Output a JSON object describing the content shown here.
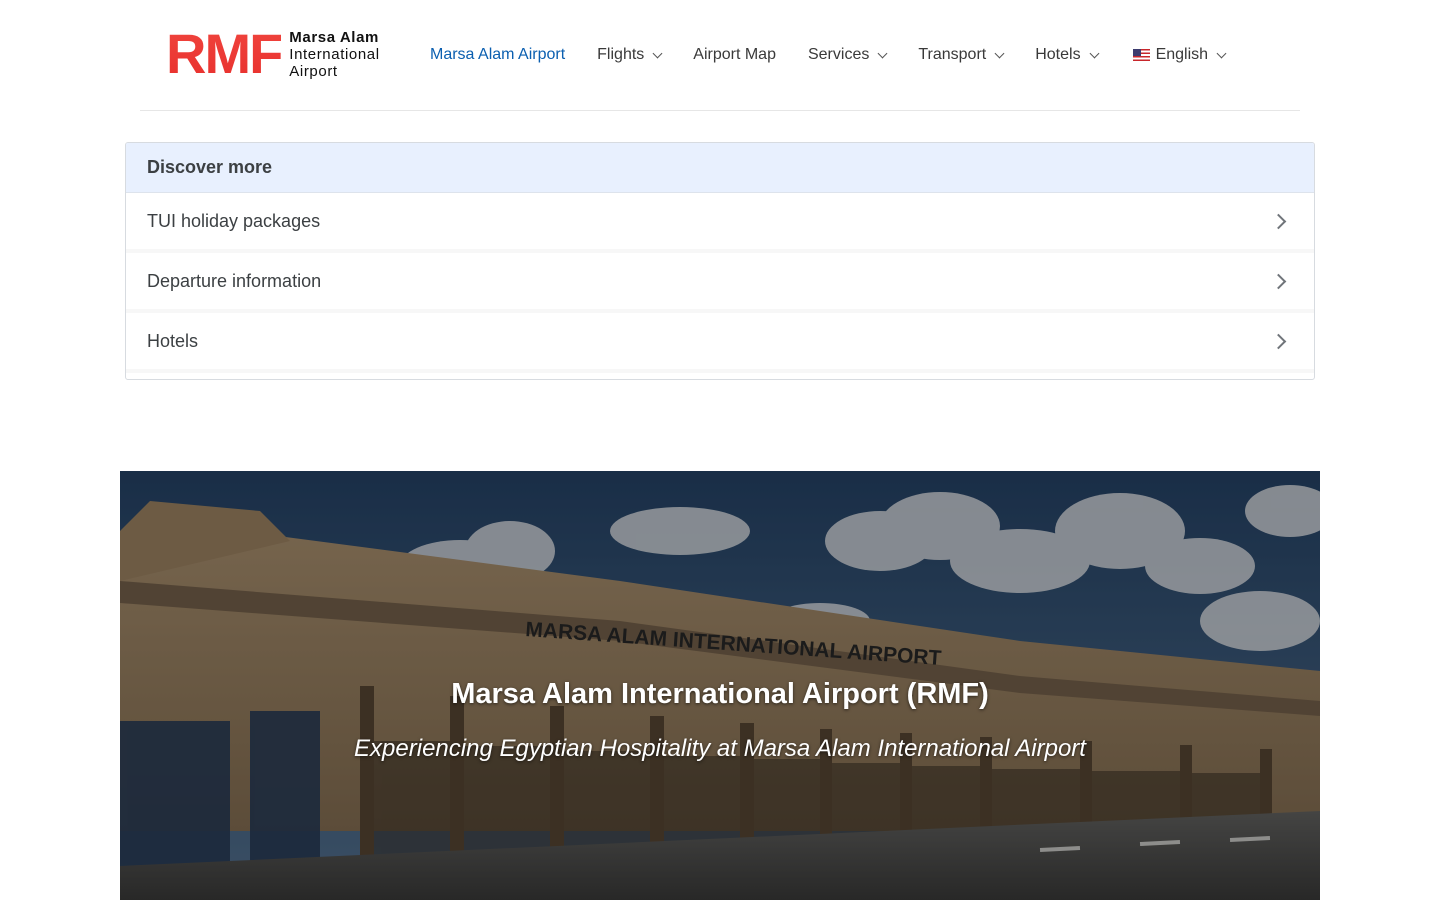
{
  "header": {
    "logo_mark": "RMF",
    "logo_line1": "Marsa Alam",
    "logo_line2": "International",
    "logo_line3": "Airport",
    "nav": [
      {
        "label": "Marsa Alam Airport",
        "active": true,
        "dropdown": false
      },
      {
        "label": "Flights",
        "active": false,
        "dropdown": true
      },
      {
        "label": "Airport Map",
        "active": false,
        "dropdown": false
      },
      {
        "label": "Services",
        "active": false,
        "dropdown": true
      },
      {
        "label": "Transport",
        "active": false,
        "dropdown": true
      },
      {
        "label": "Hotels",
        "active": false,
        "dropdown": true
      }
    ],
    "language": {
      "label": "English",
      "flag_icon": "us-flag-icon"
    }
  },
  "discover": {
    "title": "Discover more",
    "items": [
      {
        "label": "TUI holiday packages"
      },
      {
        "label": "Departure information"
      },
      {
        "label": "Hotels"
      }
    ]
  },
  "hero": {
    "sign_text": "MARSA ALAM INTERNATIONAL AIRPORT",
    "title": "Marsa Alam International Airport (RMF)",
    "subtitle": "Experiencing Egyptian Hospitality at Marsa Alam International Airport"
  },
  "colors": {
    "brand_red": "#ee3a36",
    "nav_active": "#0b5fb0",
    "discover_header_bg": "#e8f0fe"
  }
}
